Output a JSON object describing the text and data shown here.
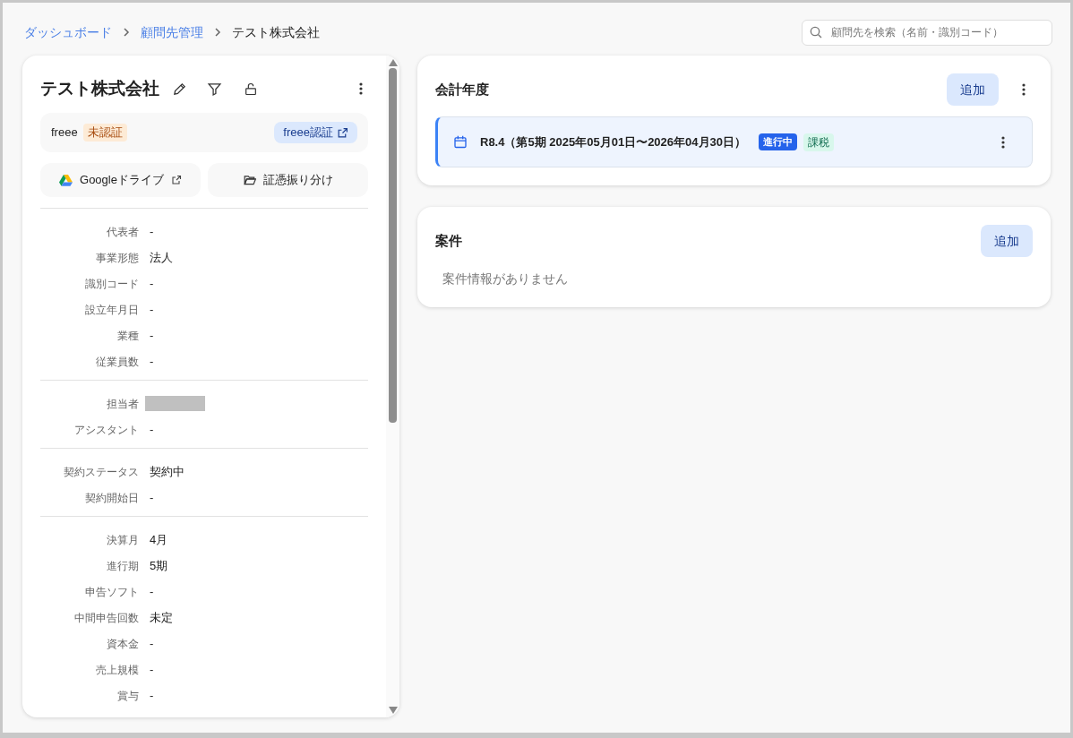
{
  "breadcrumbs": [
    {
      "label": "ダッシュボード",
      "link": true
    },
    {
      "label": "顧問先管理",
      "link": true
    },
    {
      "label": "テスト株式会社",
      "link": false
    }
  ],
  "search": {
    "placeholder": "顧問先を検索（名前・識別コード）"
  },
  "client": {
    "name": "テスト株式会社",
    "freee": {
      "label": "freee",
      "status": "未認証",
      "button": "freee認証"
    },
    "actions": [
      {
        "kind": "drive",
        "label": "Googleドライブ"
      },
      {
        "kind": "folder",
        "label": "証憑振り分け"
      }
    ],
    "groups": [
      [
        {
          "label": "代表者",
          "value": "-"
        },
        {
          "label": "事業形態",
          "value": "法人"
        },
        {
          "label": "識別コード",
          "value": "-"
        },
        {
          "label": "設立年月日",
          "value": "-"
        },
        {
          "label": "業種",
          "value": "-"
        },
        {
          "label": "従業員数",
          "value": "-"
        }
      ],
      [
        {
          "label": "担当者",
          "kind": "redacted"
        },
        {
          "label": "アシスタント",
          "value": "-"
        }
      ],
      [
        {
          "label": "契約ステータス",
          "value": "契約中"
        },
        {
          "label": "契約開始日",
          "value": "-"
        }
      ],
      [
        {
          "label": "決算月",
          "value": "4月"
        },
        {
          "label": "進行期",
          "value": "5期"
        },
        {
          "label": "申告ソフト",
          "value": "-"
        },
        {
          "label": "中間申告回数",
          "value": "未定"
        },
        {
          "label": "資本金",
          "value": "-"
        },
        {
          "label": "売上規模",
          "value": "-"
        },
        {
          "label": "賞与",
          "value": "-"
        }
      ]
    ]
  },
  "fiscal_years": {
    "title": "会計年度",
    "add": "追加",
    "items": [
      {
        "label": "R8.4（第5期 2025年05月01日〜2026年04月30日）",
        "tags": [
          {
            "label": "進行中",
            "kind": "status"
          },
          {
            "label": "課税",
            "kind": "tax"
          }
        ]
      }
    ]
  },
  "projects": {
    "title": "案件",
    "add": "追加",
    "empty": "案件情報がありません"
  }
}
